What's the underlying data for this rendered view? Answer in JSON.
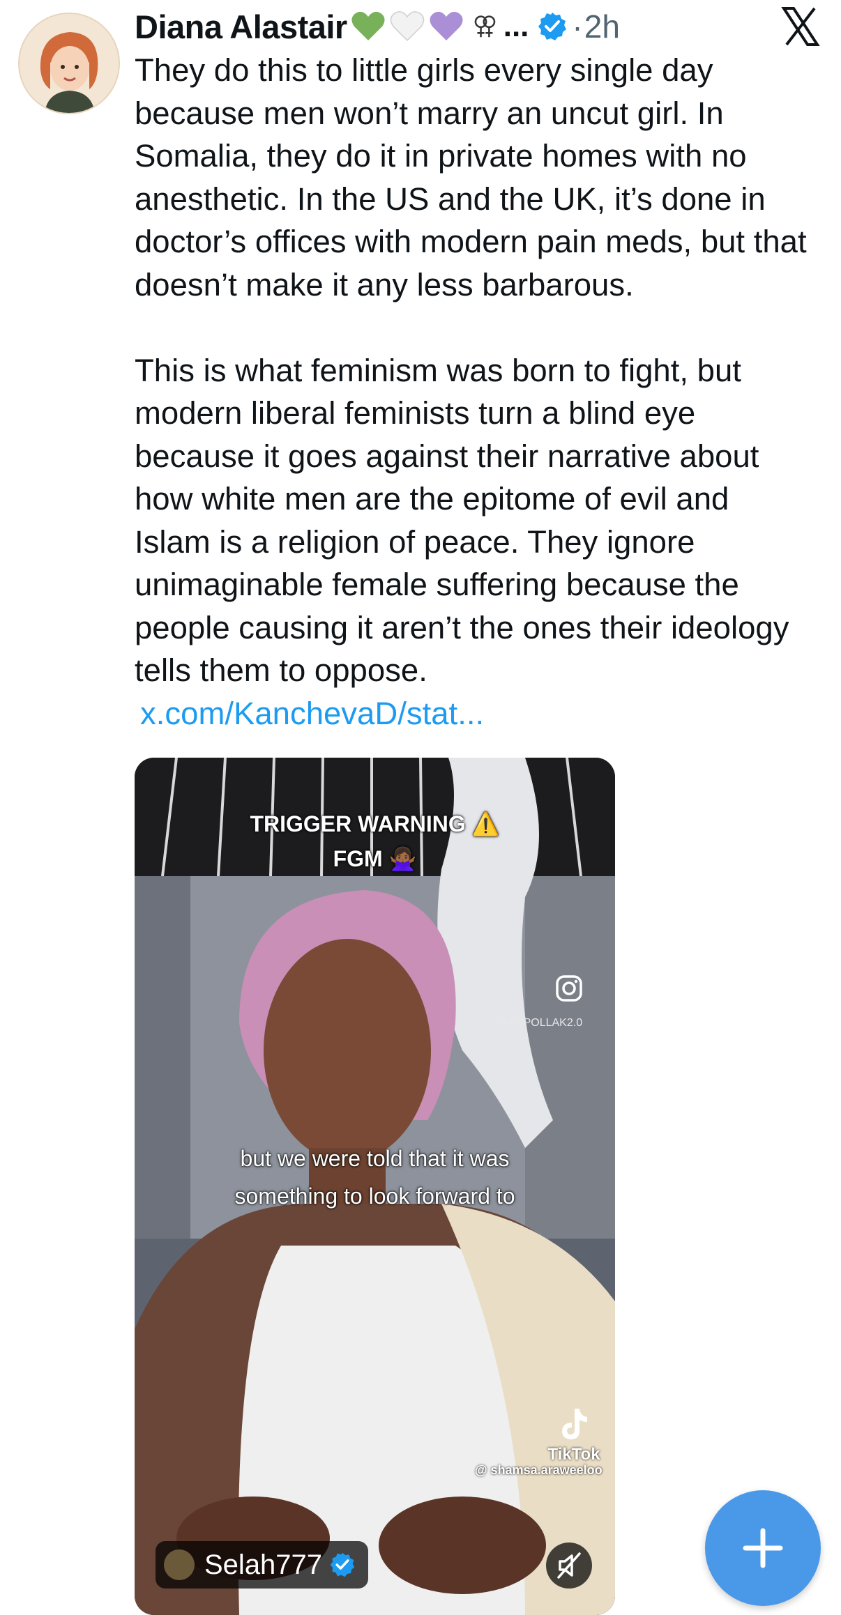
{
  "author": {
    "name": "Diana Alastair",
    "emojis": [
      "green-heart",
      "white-heart",
      "purple-heart",
      "female-symbols"
    ],
    "ellipsis": "...",
    "separator": "·",
    "time": "2h"
  },
  "tweet": {
    "paragraph1": "They do this to little girls every single day because men won’t marry an uncut girl. In Somalia, they do it in private homes with no anesthetic. In the US and the UK, it’s done in doctor’s offices with modern pain meds, but that doesn’t make it any less barbarous.",
    "paragraph2": "This is what feminism was born to fight, but modern liberal feminists turn a blind eye because it goes against their narrative about how white men are the epitome of evil and Islam is a religion of peace. They ignore unimaginable female suffering because the people causing it aren’t the ones their ideology tells them to oppose.",
    "link": "x.com/KanchevaD/stat..."
  },
  "media": {
    "warning_line1": "TRIGGER WARNING ⚠️",
    "warning_line2": "FGM 🙅🏾‍♀️",
    "instagram_handle": "@SSPOLLAK2.0",
    "caption_line1": "but we were told that it was",
    "caption_line2": "something to look forward to",
    "tiktok_label": "TikTok",
    "tiktok_handle": "@ shamsa.araweeloo",
    "uploader": "Selah777"
  },
  "colors": {
    "link": "#1d9bf0",
    "verified": "#1d9bf0",
    "fab": "#4a99e9",
    "secondary_text": "#536471"
  },
  "icons": [
    "x-logo-icon",
    "verified-badge-icon",
    "instagram-icon",
    "tiktok-icon",
    "mute-icon",
    "plus-icon"
  ]
}
